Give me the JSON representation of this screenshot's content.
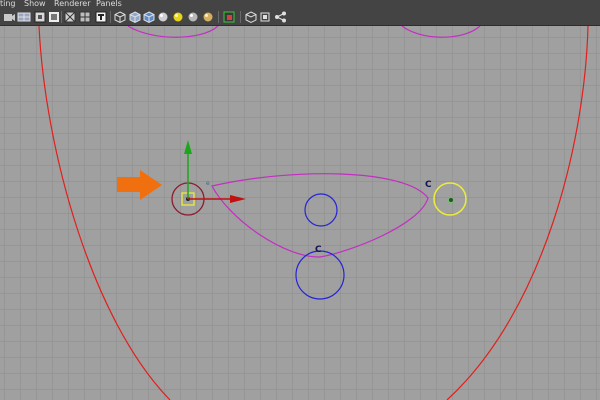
{
  "menubar": {
    "items": [
      "ting",
      "Show",
      "Renderer",
      "Panels"
    ]
  },
  "toolbar": {
    "icons": [
      "camera-icon",
      "grid-icon",
      "bookmark-icon",
      "image-plane-icon",
      "gate-mask-icon",
      "resolution-gate-icon",
      "texture-icon",
      "wireframe-cube-icon",
      "smooth-shade-icon",
      "textured-cube-icon",
      "default-light-icon",
      "shadow-sphere-icon",
      "ambient-occlusion-icon",
      "isolate-select-icon",
      "xray-icon",
      "xray-joints-icon",
      "xray-components-icon"
    ]
  },
  "viewport": {
    "curve_labels": {
      "left_control": "C",
      "right_control": "C",
      "pivot_hint": "e"
    }
  },
  "colors": {
    "ui_bg": "#444444",
    "viewport_bg": "#a0a0a0",
    "grid_line": "#8c8c8c",
    "face_curve": "#e0201c",
    "mouth_curve": "#c22ec2",
    "blue_ctrl": "#2424d6",
    "yellow_ctrl": "#ecec3a",
    "move_y": "#1aa81a",
    "move_x": "#c01010",
    "arrow": "#f07010"
  }
}
